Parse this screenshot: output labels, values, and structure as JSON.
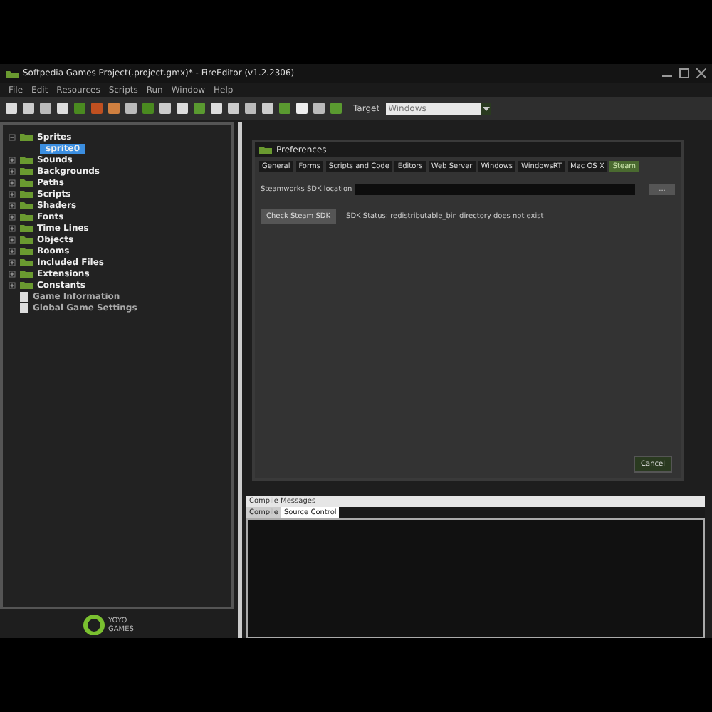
{
  "window": {
    "title": "Softpedia Games Project(.project.gmx)* - FireEditor (v1.2.2306)"
  },
  "menu": [
    "File",
    "Edit",
    "Resources",
    "Scripts",
    "Run",
    "Window",
    "Help"
  ],
  "toolbar": {
    "target_label": "Target",
    "target_value": "Windows"
  },
  "tree": [
    {
      "label": "Sprites",
      "kind": "folder",
      "expanded": true,
      "children": [
        {
          "label": "sprite0",
          "selected": true
        }
      ]
    },
    {
      "label": "Sounds",
      "kind": "folder",
      "expanded": false
    },
    {
      "label": "Backgrounds",
      "kind": "folder",
      "expanded": false
    },
    {
      "label": "Paths",
      "kind": "folder",
      "expanded": false
    },
    {
      "label": "Scripts",
      "kind": "folder",
      "expanded": false
    },
    {
      "label": "Shaders",
      "kind": "folder",
      "expanded": false
    },
    {
      "label": "Fonts",
      "kind": "folder",
      "expanded": false
    },
    {
      "label": "Time Lines",
      "kind": "folder",
      "expanded": false
    },
    {
      "label": "Objects",
      "kind": "folder",
      "expanded": false
    },
    {
      "label": "Rooms",
      "kind": "folder",
      "expanded": false
    },
    {
      "label": "Included Files",
      "kind": "folder",
      "expanded": false
    },
    {
      "label": "Extensions",
      "kind": "folder",
      "expanded": false
    },
    {
      "label": "Constants",
      "kind": "folder",
      "expanded": false
    },
    {
      "label": "Game Information",
      "kind": "doc"
    },
    {
      "label": "Global Game Settings",
      "kind": "doc"
    }
  ],
  "logo": {
    "line1": "YOYO",
    "line2": "GAMES"
  },
  "preferences": {
    "title": "Preferences",
    "tabs": [
      {
        "label": "General",
        "selected": false
      },
      {
        "label": "Forms",
        "selected": false
      },
      {
        "label": "Scripts and Code",
        "selected": false
      },
      {
        "label": "Editors",
        "selected": false
      },
      {
        "label": "Web Server",
        "selected": false
      },
      {
        "label": "Windows",
        "selected": false
      },
      {
        "label": "WindowsRT",
        "selected": false
      },
      {
        "label": "Mac OS X",
        "selected": false
      },
      {
        "label": "Steam",
        "selected": true
      }
    ],
    "sdk_label": "Steamworks SDK location",
    "browse": "...",
    "check_button": "Check Steam SDK",
    "status": "SDK Status: redistributable_bin directory does not exist",
    "cancel": "Cancel"
  },
  "compile": {
    "title": "Compile Messages",
    "tabs": [
      {
        "label": "Compile",
        "selected": false
      },
      {
        "label": "Source Control",
        "selected": true
      }
    ]
  }
}
